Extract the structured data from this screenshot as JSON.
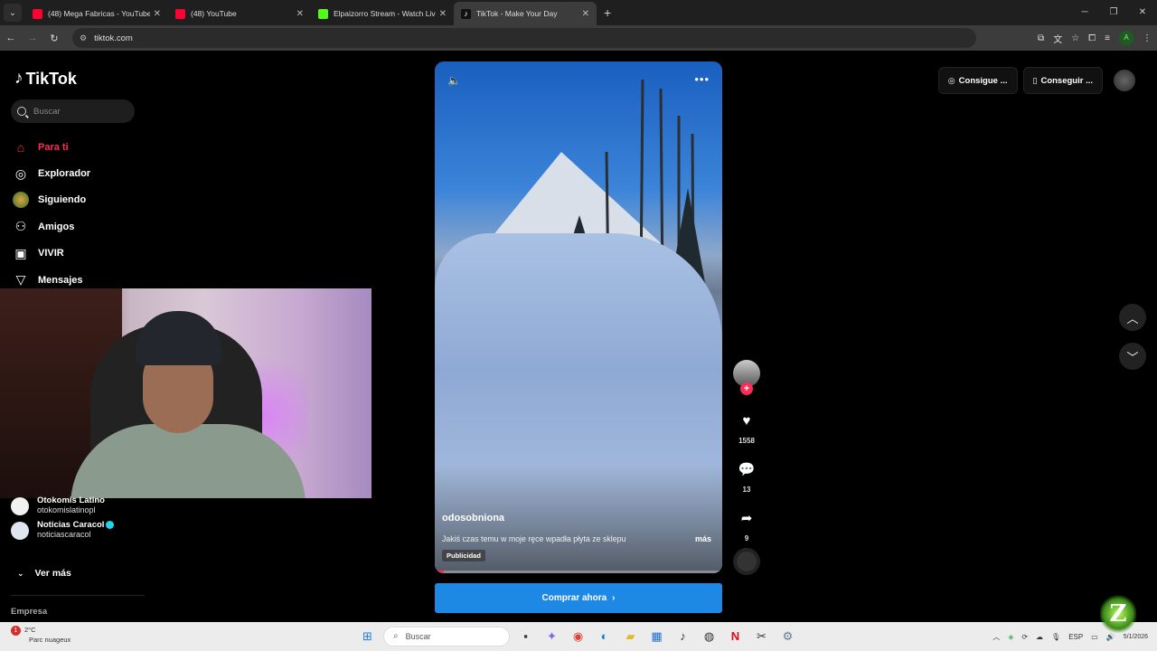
{
  "browser": {
    "tabs": [
      {
        "title": "(48) Mega Fabricas - YouTube",
        "favicon_color": "#ff0033",
        "active": false
      },
      {
        "title": "(48) YouTube",
        "favicon_color": "#ff0033",
        "active": false
      },
      {
        "title": "Elpaizorro Stream - Watch Live",
        "favicon_color": "#53fc18",
        "active": false
      },
      {
        "title": "TikTok - Make Your Day",
        "favicon_color": "#ffffff",
        "active": true
      }
    ],
    "url": "tiktok.com"
  },
  "sidebar": {
    "logo": "TikTok",
    "search_placeholder": "Buscar",
    "nav": [
      {
        "label": "Para ti",
        "icon": "home-icon",
        "active": true
      },
      {
        "label": "Explorador",
        "icon": "compass-icon",
        "active": false
      },
      {
        "label": "Siguiendo",
        "icon": "following-avatar-icon",
        "active": false
      },
      {
        "label": "Amigos",
        "icon": "friends-icon",
        "active": false
      },
      {
        "label": "VIVIR",
        "icon": "live-icon",
        "active": false
      },
      {
        "label": "Mensajes",
        "icon": "messages-icon",
        "active": false
      }
    ],
    "following": [
      {
        "name": "Otokomis Latino",
        "handle": "otokomislatinopl",
        "verified": false
      },
      {
        "name": "Noticias Caracol",
        "handle": "noticiascaracol",
        "verified": true
      }
    ],
    "ver_mas": "Ver más",
    "empresa": "Empresa"
  },
  "top_right": {
    "coins_label": "Consigue ...",
    "app_label": "Conseguir ..."
  },
  "video": {
    "author": "odosobniona",
    "caption": "Jakiś czas temu w moje ręce wpadła płyta ze sklepu",
    "more": "más",
    "ad_label": "Publicidad",
    "progress": 0.03,
    "cta": "Comprar ahora"
  },
  "actions": {
    "likes": "1558",
    "comments": "13",
    "shares": "9"
  },
  "taskbar": {
    "weather_temp": "2°C",
    "weather_desc": "Parc nuageux",
    "notification_count": "1",
    "search_placeholder": "Buscar",
    "language": "ESP",
    "date": "5/1/2026"
  },
  "colors": {
    "accent": "#fe2c55",
    "cta_blue": "#1e88e5"
  }
}
